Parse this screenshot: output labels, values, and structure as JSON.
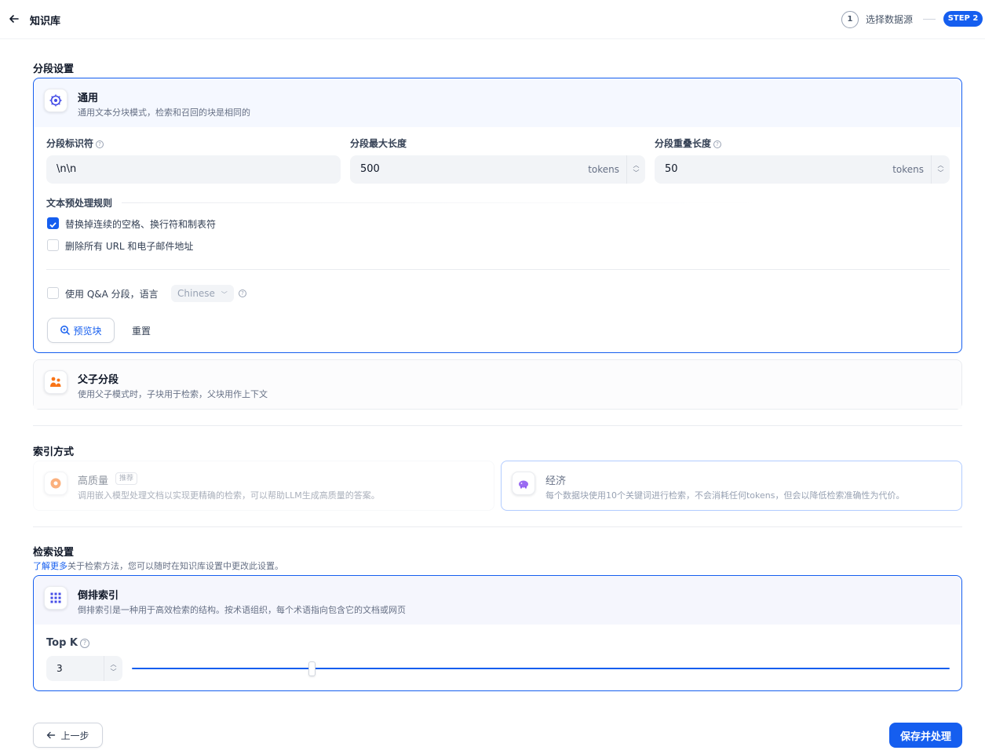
{
  "header": {
    "title": "知识库",
    "steps": [
      {
        "number": "1",
        "label": "选择数据源"
      },
      {
        "label": "STEP 2"
      }
    ]
  },
  "segment": {
    "section_title": "分段设置",
    "general": {
      "title": "通用",
      "desc": "通用文本分块模式，检索和召回的块是相同的",
      "separator_label": "分段标识符",
      "separator_value": "\\n\\n",
      "max_length_label": "分段最大长度",
      "max_length_value": "500",
      "overlap_label": "分段重叠长度",
      "overlap_value": "50",
      "unit": "tokens",
      "rules_title": "文本预处理规则",
      "rule1": "替换掉连续的空格、换行符和制表符",
      "rule1_checked": true,
      "rule2": "删除所有 URL 和电子邮件地址",
      "rule2_checked": false,
      "qa_label": "使用 Q&A 分段，语言",
      "qa_language": "Chinese",
      "preview_button": "预览块",
      "reset_button": "重置"
    },
    "parent_child": {
      "title": "父子分段",
      "desc": "使用父子模式时，子块用于检索，父块用作上下文"
    }
  },
  "index": {
    "section_title": "索引方式",
    "high_quality": {
      "title": "高质量",
      "badge": "推荐",
      "desc": "调用嵌入模型处理文档以实现更精确的检索，可以帮助LLM生成高质量的答案。"
    },
    "economy": {
      "title": "经济",
      "desc": "每个数据块使用10个关键词进行检索，不会消耗任何tokens，但会以降低检索准确性为代价。"
    }
  },
  "retrieval": {
    "section_title": "检索设置",
    "learn_more": "了解更多",
    "subtitle_rest": "关于检索方法，您可以随时在知识库设置中更改此设置。",
    "inverted": {
      "title": "倒排索引",
      "desc": "倒排索引是一种用于高效检索的结构。按术语组织，每个术语指向包含它的文档或网页"
    },
    "topk_label": "Top K",
    "topk_value": "3",
    "topk_slider_fraction": 0.22
  },
  "footer": {
    "back_button": "上一步",
    "save_button": "保存并处理"
  },
  "colors": {
    "primary": "#155eef",
    "card_border_active": "#155eef",
    "icon_orange": "#f97316",
    "icon_purple": "#7839ee"
  }
}
